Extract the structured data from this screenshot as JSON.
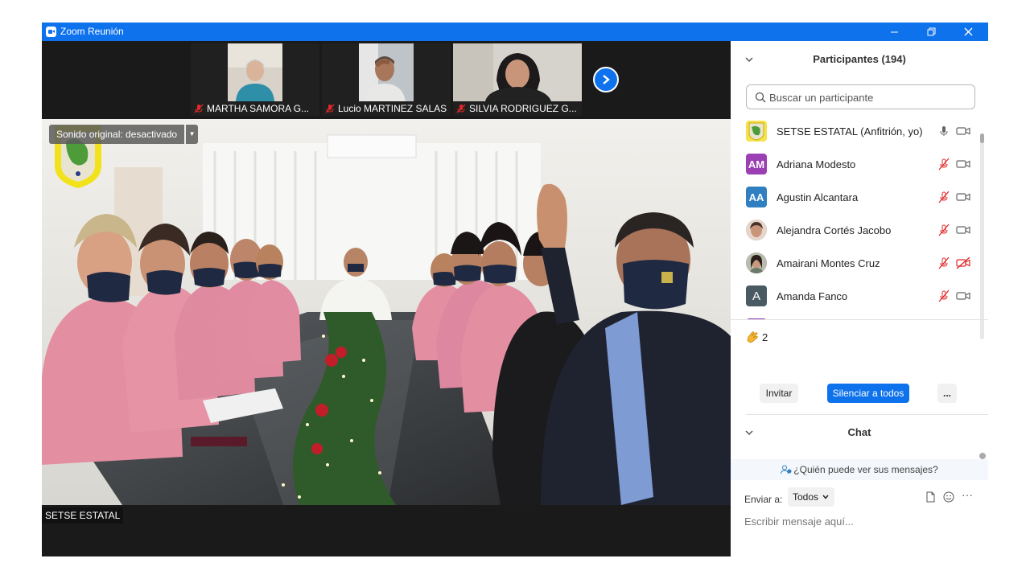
{
  "window": {
    "title": "Zoom Reunión"
  },
  "thumbnails": [
    {
      "name": "MARTHA SAMORA G..."
    },
    {
      "name": "Lucio MARTINEZ SALAS"
    },
    {
      "name": "SILVIA RODRIGUEZ G..."
    }
  ],
  "main_video": {
    "original_sound": "Sonido original: desactivado",
    "speaker": "SETSE ESTATAL"
  },
  "participants_panel": {
    "title": "Participantes (194)",
    "search_placeholder": "Buscar un participante",
    "participants": [
      {
        "name": "SETSE ESTATAL (Anfitrión, yo)",
        "initials": "",
        "avatar_color": "#f5e24c",
        "muted": false,
        "video_off": false
      },
      {
        "name": "Adriana Modesto",
        "initials": "AM",
        "avatar_color": "#9b3fb5",
        "muted": true,
        "video_off": false
      },
      {
        "name": "Agustin Alcantara",
        "initials": "AA",
        "avatar_color": "#2f7fc1",
        "muted": true,
        "video_off": false
      },
      {
        "name": "Alejandra Cortés Jacobo",
        "initials": "",
        "avatar_color": "#c99f8a",
        "muted": true,
        "video_off": false
      },
      {
        "name": "Amairani Montes Cruz",
        "initials": "",
        "avatar_color": "#8a8f7a",
        "muted": true,
        "video_off": true
      },
      {
        "name": "Amanda Fanco",
        "initials": "A",
        "avatar_color": "#4a5a63",
        "muted": true,
        "video_off": false
      }
    ],
    "reactions": {
      "count": "2"
    },
    "invite_label": "Invitar",
    "mute_all_label": "Silenciar a todos",
    "more_label": "..."
  },
  "chat": {
    "title": "Chat",
    "who_can_see": "¿Quién puede ver sus mensajes?",
    "send_to_label": "Enviar a:",
    "send_to_value": "Todos",
    "more_label": "···",
    "input_placeholder": "Escribir mensaje aquí..."
  },
  "colors": {
    "accent": "#0e72ed",
    "mute_red": "#e02828"
  }
}
